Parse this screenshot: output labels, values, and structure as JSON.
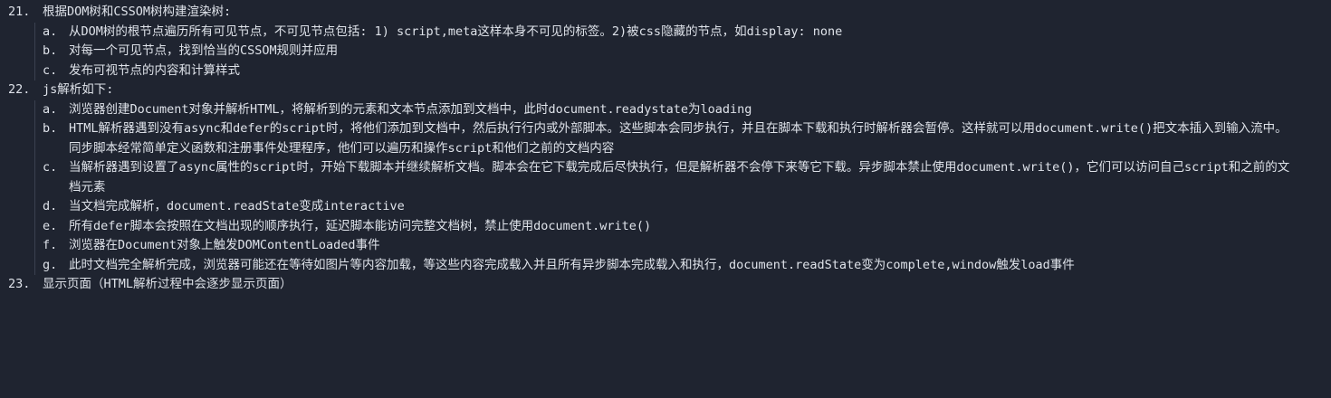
{
  "items": [
    {
      "number": "21.",
      "text": "根据DOM树和CSSOM树构建渲染树:",
      "subs": [
        {
          "marker": "a.",
          "text": "从DOM树的根节点遍历所有可见节点，不可见节点包括: 1) script,meta这样本身不可见的标签。2)被css隐藏的节点，如display: none"
        },
        {
          "marker": "b.",
          "text": "对每一个可见节点，找到恰当的CSSOM规则并应用"
        },
        {
          "marker": "c.",
          "text": "发布可视节点的内容和计算样式"
        }
      ]
    },
    {
      "number": "22.",
      "text": "js解析如下:",
      "subs": [
        {
          "marker": "a.",
          "text": "浏览器创建Document对象并解析HTML，将解析到的元素和文本节点添加到文档中，此时document.readystate为loading"
        },
        {
          "marker": "b.",
          "text": "HTML解析器遇到没有async和defer的script时，将他们添加到文档中，然后执行行内或外部脚本。这些脚本会同步执行，并且在脚本下载和执行时解析器会暂停。这样就可以用document.write()把文本插入到输入流中。同步脚本经常简单定义函数和注册事件处理程序，他们可以遍历和操作script和他们之前的文档内容"
        },
        {
          "marker": "c.",
          "text": "当解析器遇到设置了async属性的script时，开始下载脚本并继续解析文档。脚本会在它下载完成后尽快执行，但是解析器不会停下来等它下载。异步脚本禁止使用document.write()，它们可以访问自己script和之前的文档元素"
        },
        {
          "marker": "d.",
          "text": "当文档完成解析，document.readState变成interactive"
        },
        {
          "marker": "e.",
          "text": "所有defer脚本会按照在文档出现的顺序执行，延迟脚本能访问完整文档树，禁止使用document.write()"
        },
        {
          "marker": "f.",
          "text": "浏览器在Document对象上触发DOMContentLoaded事件"
        },
        {
          "marker": "g.",
          "text": "此时文档完全解析完成，浏览器可能还在等待如图片等内容加载，等这些内容完成载入并且所有异步脚本完成载入和执行，document.readState变为complete,window触发load事件"
        }
      ]
    },
    {
      "number": "23.",
      "text": "显示页面（HTML解析过程中会逐步显示页面）",
      "subs": []
    }
  ]
}
